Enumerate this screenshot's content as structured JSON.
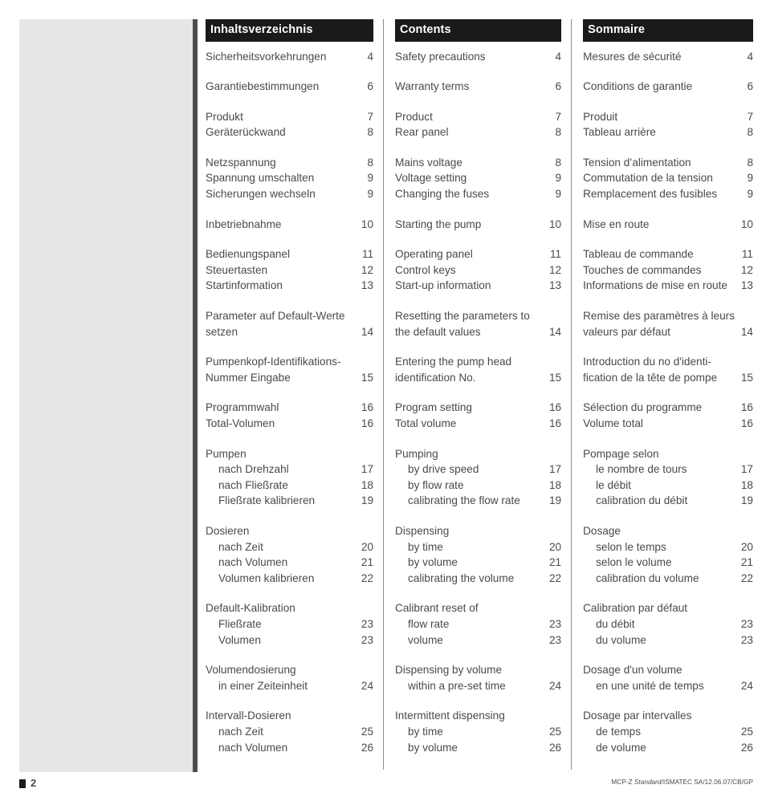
{
  "footer": {
    "page_number": "2",
    "reference_prefix": "MCP-Z ",
    "reference_italic": "Standard",
    "reference_suffix": "/ISMATEC SA/12.06.07/CB/GP"
  },
  "colors": {
    "header_bg": "#1a1a1a",
    "header_text": "#ffffff",
    "text": "#4a4a4a",
    "panel_grey": "#e6e6e6",
    "panel_edge": "#4d4d4d",
    "rule": "#8a8a8a"
  },
  "columns": [
    {
      "id": "german",
      "title": "Inhaltsverzeichnis",
      "groups": [
        {
          "rows": [
            {
              "label": "Sicherheitsvorkehrungen",
              "page": "4"
            }
          ]
        },
        {
          "rows": [
            {
              "label": "Garantiebestimmungen",
              "page": "6"
            }
          ]
        },
        {
          "rows": [
            {
              "label": "Produkt",
              "page": "7"
            },
            {
              "label": "Geräterückwand",
              "page": "8"
            }
          ]
        },
        {
          "rows": [
            {
              "label": "Netzspannung",
              "page": "8"
            },
            {
              "label": "Spannung umschalten",
              "page": "9"
            },
            {
              "label": "Sicherungen wechseln",
              "page": "9"
            }
          ]
        },
        {
          "rows": [
            {
              "label": "Inbetriebnahme",
              "page": "10"
            }
          ]
        },
        {
          "rows": [
            {
              "label": "Bedienungspanel",
              "page": "11"
            },
            {
              "label": "Steuertasten",
              "page": "12"
            },
            {
              "label": "Startinformation",
              "page": "13"
            }
          ]
        },
        {
          "rows": [
            {
              "label": "Parameter auf Default-Werte",
              "page": ""
            },
            {
              "label": "setzen",
              "page": "14"
            }
          ]
        },
        {
          "rows": [
            {
              "label": "Pumpenkopf-Identifikations-",
              "page": ""
            },
            {
              "label": "Nummer Eingabe",
              "page": "15"
            }
          ]
        },
        {
          "rows": [
            {
              "label": "Programmwahl",
              "page": "16"
            },
            {
              "label": "Total-Volumen",
              "page": "16"
            }
          ]
        },
        {
          "rows": [
            {
              "label": "Pumpen",
              "page": ""
            },
            {
              "label": "nach Drehzahl",
              "page": "17",
              "indent": true
            },
            {
              "label": "nach Fließrate",
              "page": "18",
              "indent": true
            },
            {
              "label": "Fließrate kalibrieren",
              "page": "19",
              "indent": true
            }
          ]
        },
        {
          "rows": [
            {
              "label": "Dosieren",
              "page": ""
            },
            {
              "label": "nach Zeit",
              "page": "20",
              "indent": true
            },
            {
              "label": "nach Volumen",
              "page": "21",
              "indent": true
            },
            {
              "label": "Volumen kalibrieren",
              "page": "22",
              "indent": true
            }
          ]
        },
        {
          "rows": [
            {
              "label": "Default-Kalibration",
              "page": ""
            },
            {
              "label": "Fließrate",
              "page": "23",
              "indent": true
            },
            {
              "label": "Volumen",
              "page": "23",
              "indent": true
            }
          ]
        },
        {
          "rows": [
            {
              "label": "Volumendosierung",
              "page": ""
            },
            {
              "label": "in einer Zeiteinheit",
              "page": "24",
              "indent": true
            }
          ]
        },
        {
          "rows": [
            {
              "label": "Intervall-Dosieren",
              "page": ""
            },
            {
              "label": "nach Zeit",
              "page": "25",
              "indent": true
            },
            {
              "label": "nach Volumen",
              "page": "26",
              "indent": true
            }
          ]
        }
      ]
    },
    {
      "id": "english",
      "title": "Contents",
      "groups": [
        {
          "rows": [
            {
              "label": "Safety precautions",
              "page": "4"
            }
          ]
        },
        {
          "rows": [
            {
              "label": "Warranty terms",
              "page": "6"
            }
          ]
        },
        {
          "rows": [
            {
              "label": "Product",
              "page": "7"
            },
            {
              "label": "Rear panel",
              "page": "8"
            }
          ]
        },
        {
          "rows": [
            {
              "label": "Mains voltage",
              "page": "8"
            },
            {
              "label": "Voltage setting",
              "page": "9"
            },
            {
              "label": "Changing the fuses",
              "page": "9"
            }
          ]
        },
        {
          "rows": [
            {
              "label": "Starting the pump",
              "page": "10"
            }
          ]
        },
        {
          "rows": [
            {
              "label": "Operating panel",
              "page": "11"
            },
            {
              "label": "Control keys",
              "page": "12"
            },
            {
              "label": "Start-up information",
              "page": "13"
            }
          ]
        },
        {
          "rows": [
            {
              "label": "Resetting the parameters to",
              "page": ""
            },
            {
              "label": "the default values",
              "page": "14"
            }
          ]
        },
        {
          "rows": [
            {
              "label": "Entering the pump head",
              "page": ""
            },
            {
              "label": "identification No.",
              "page": "15"
            }
          ]
        },
        {
          "rows": [
            {
              "label": "Program setting",
              "page": "16"
            },
            {
              "label": "Total volume",
              "page": "16"
            }
          ]
        },
        {
          "rows": [
            {
              "label": "Pumping",
              "page": ""
            },
            {
              "label": "by drive speed",
              "page": "17",
              "indent": true
            },
            {
              "label": "by flow rate",
              "page": "18",
              "indent": true
            },
            {
              "label": "calibrating the flow rate",
              "page": "19",
              "indent": true
            }
          ]
        },
        {
          "rows": [
            {
              "label": "Dispensing",
              "page": ""
            },
            {
              "label": "by time",
              "page": "20",
              "indent": true
            },
            {
              "label": "by volume",
              "page": "21",
              "indent": true
            },
            {
              "label": "calibrating the volume",
              "page": "22",
              "indent": true
            }
          ]
        },
        {
          "rows": [
            {
              "label": "Calibrant reset of",
              "page": ""
            },
            {
              "label": "flow rate",
              "page": "23",
              "indent": true
            },
            {
              "label": "volume",
              "page": "23",
              "indent": true
            }
          ]
        },
        {
          "rows": [
            {
              "label": "Dispensing by volume",
              "page": ""
            },
            {
              "label": "within a pre-set time",
              "page": "24",
              "indent": true
            }
          ]
        },
        {
          "rows": [
            {
              "label": "Intermittent dispensing",
              "page": ""
            },
            {
              "label": "by time",
              "page": "25",
              "indent": true
            },
            {
              "label": "by volume",
              "page": "26",
              "indent": true
            }
          ]
        }
      ]
    },
    {
      "id": "french",
      "title": "Sommaire",
      "groups": [
        {
          "rows": [
            {
              "label": "Mesures de sécurité",
              "page": "4"
            }
          ]
        },
        {
          "rows": [
            {
              "label": "Conditions de garantie",
              "page": "6"
            }
          ]
        },
        {
          "rows": [
            {
              "label": "Produit",
              "page": "7"
            },
            {
              "label": "Tableau arrière",
              "page": "8"
            }
          ]
        },
        {
          "rows": [
            {
              "label": "Tension d’alimentation",
              "page": "8"
            },
            {
              "label": "Commutation de la tension",
              "page": "9"
            },
            {
              "label": "Remplacement des fusibles",
              "page": "9"
            }
          ]
        },
        {
          "rows": [
            {
              "label": "Mise en route",
              "page": "10"
            }
          ]
        },
        {
          "rows": [
            {
              "label": "Tableau de commande",
              "page": "11"
            },
            {
              "label": "Touches de commandes",
              "page": "12"
            },
            {
              "label": "Informations de mise en route",
              "page": "13"
            }
          ]
        },
        {
          "rows": [
            {
              "label": "Remise des paramètres à leurs",
              "page": ""
            },
            {
              "label": "valeurs par défaut",
              "page": "14"
            }
          ]
        },
        {
          "rows": [
            {
              "label": "Introduction du no d'identi-",
              "page": ""
            },
            {
              "label": "fication de la tête de pompe",
              "page": "15"
            }
          ]
        },
        {
          "rows": [
            {
              "label": "Sélection du programme",
              "page": "16"
            },
            {
              "label": "Volume total",
              "page": "16"
            }
          ]
        },
        {
          "rows": [
            {
              "label": "Pompage selon",
              "page": ""
            },
            {
              "label": "le nombre de tours",
              "page": "17",
              "indent": true
            },
            {
              "label": "le débit",
              "page": "18",
              "indent": true
            },
            {
              "label": "calibration du débit",
              "page": "19",
              "indent": true
            }
          ]
        },
        {
          "rows": [
            {
              "label": "Dosage",
              "page": ""
            },
            {
              "label": "selon le temps",
              "page": "20",
              "indent": true
            },
            {
              "label": "selon le volume",
              "page": "21",
              "indent": true
            },
            {
              "label": "calibration du volume",
              "page": "22",
              "indent": true
            }
          ]
        },
        {
          "rows": [
            {
              "label": "Calibration par défaut",
              "page": ""
            },
            {
              "label": "du débit",
              "page": "23",
              "indent": true
            },
            {
              "label": "du volume",
              "page": "23",
              "indent": true
            }
          ]
        },
        {
          "rows": [
            {
              "label": "Dosage d'un volume",
              "page": ""
            },
            {
              "label": "en une unité de temps",
              "page": "24",
              "indent": true
            }
          ]
        },
        {
          "rows": [
            {
              "label": "Dosage par intervalles",
              "page": ""
            },
            {
              "label": "de temps",
              "page": "25",
              "indent": true
            },
            {
              "label": "de volume",
              "page": "26",
              "indent": true
            }
          ]
        }
      ]
    }
  ]
}
